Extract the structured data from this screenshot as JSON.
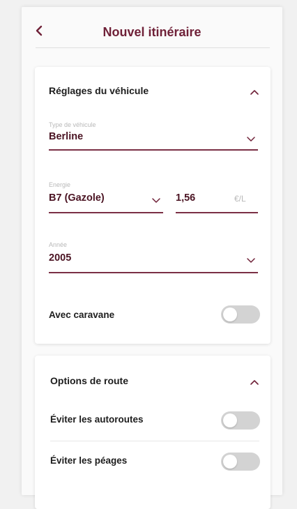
{
  "header": {
    "title": "Nouvel itinéraire",
    "back_icon": "chevron-left-icon"
  },
  "vehicle": {
    "title": "Réglages du véhicule",
    "expanded": true,
    "type": {
      "label": "Type de véhicule",
      "value": "Berline"
    },
    "energy": {
      "label": "Energie",
      "value": "B7 (Gazole)"
    },
    "price": {
      "value": "1,56",
      "unit": "€/L"
    },
    "year": {
      "label": "Année",
      "value": "2005"
    },
    "caravan": {
      "label": "Avec caravane",
      "on": false
    }
  },
  "route": {
    "title": "Options de route",
    "expanded": true,
    "avoid_highways": {
      "label": "Éviter les autoroutes",
      "on": false
    },
    "avoid_tolls": {
      "label": "Éviter les péages",
      "on": false
    }
  },
  "colors": {
    "accent": "#6f2138",
    "value_text": "#4b1423",
    "underline": "#7a2f45",
    "switch_off": "#d3d3d3"
  }
}
